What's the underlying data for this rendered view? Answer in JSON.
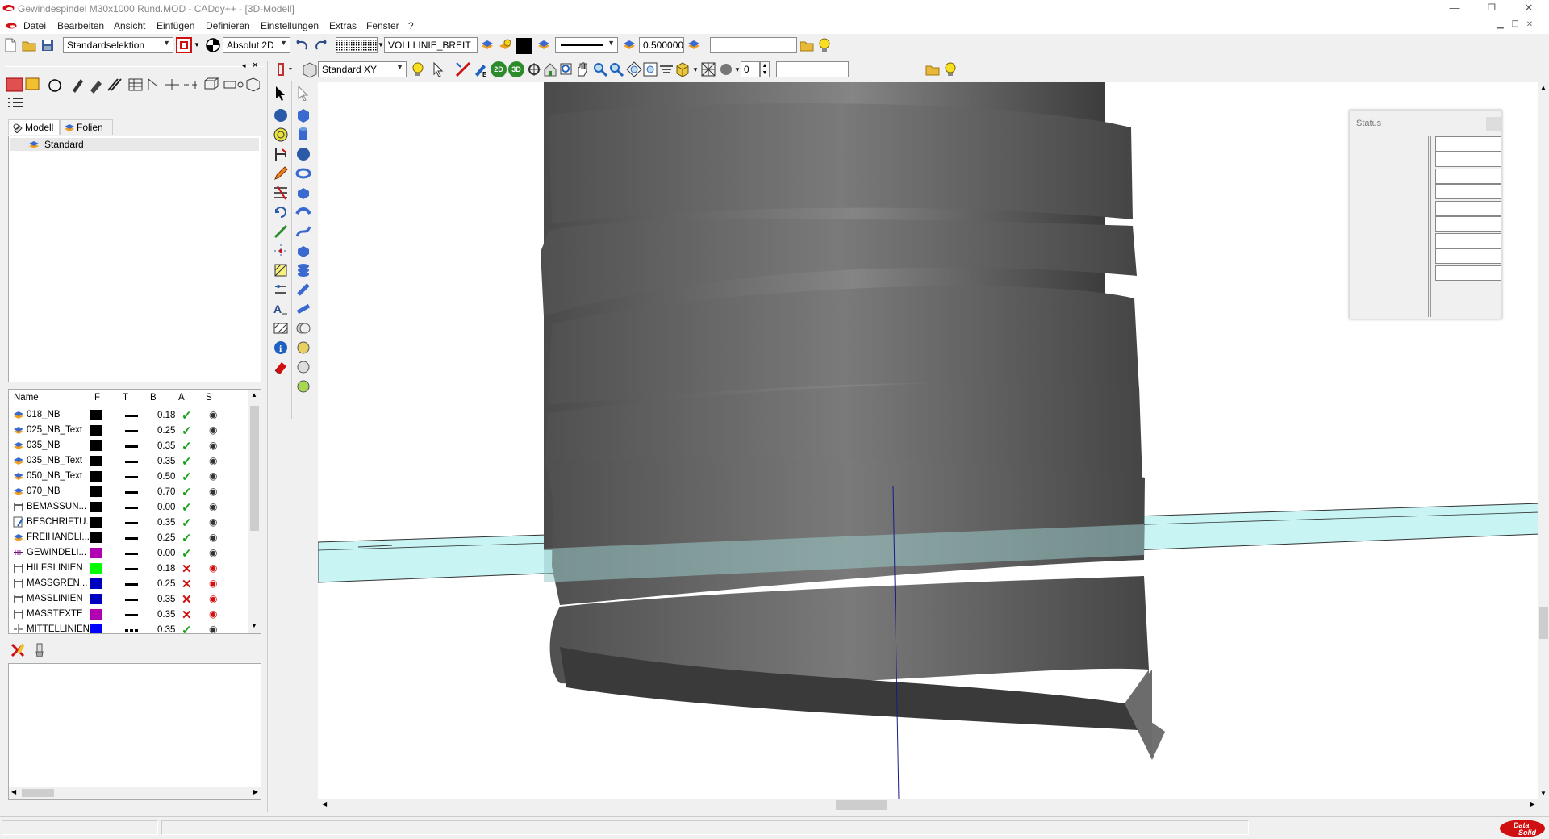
{
  "window": {
    "title": "Gewindespindel M30x1000 Rund.MOD  -  CADdy++ - [3D-Modell]",
    "minimize_glyph": "—",
    "restore_glyph": "❐",
    "close_glyph": "✕"
  },
  "menu": {
    "items": [
      "Datei",
      "Bearbeiten",
      "Ansicht",
      "Einfügen",
      "Definieren",
      "Einstellungen",
      "Extras",
      "Fenster",
      "?"
    ]
  },
  "toolbar1": {
    "selection_mode": "Standardselektion",
    "coord_mode": "Absolut 2D",
    "line_type": "VOLLLINIE_BREIT",
    "line_width": "0.500000",
    "search_value": ""
  },
  "toolbar2": {
    "view_preset": "Standard XY",
    "btn_2d": "2D",
    "btn_3d": "3D",
    "number_value": "0",
    "search_value": ""
  },
  "left_panel": {
    "tabs": [
      {
        "label": "Modell",
        "icon": "model-icon"
      },
      {
        "label": "Folien",
        "icon": "layers-icon"
      }
    ],
    "tree_items": [
      "Standard"
    ],
    "layer_columns": [
      "Name",
      "F",
      "T",
      "B",
      "A",
      "S"
    ],
    "layers": [
      {
        "name": "018_NB",
        "color": "#000000",
        "width": "0.18",
        "active": true
      },
      {
        "name": "025_NB_Text",
        "color": "#000000",
        "width": "0.25",
        "active": true
      },
      {
        "name": "035_NB",
        "color": "#000000",
        "width": "0.35",
        "active": true
      },
      {
        "name": "035_NB_Text",
        "color": "#000000",
        "width": "0.35",
        "active": true
      },
      {
        "name": "050_NB_Text",
        "color": "#000000",
        "width": "0.50",
        "active": true
      },
      {
        "name": "070_NB",
        "color": "#000000",
        "width": "0.70",
        "active": true
      },
      {
        "name": "BEMASSUN...",
        "color": "#000000",
        "width": "0.00",
        "active": true
      },
      {
        "name": "BESCHRIFTU...",
        "color": "#000000",
        "width": "0.35",
        "active": true
      },
      {
        "name": "FREIHANDLI...",
        "color": "#000000",
        "width": "0.25",
        "active": true
      },
      {
        "name": "GEWINDELI...",
        "color": "#b000b0",
        "width": "0.00",
        "active": true
      },
      {
        "name": "HILFSLINIEN",
        "color": "#00ff00",
        "width": "0.18",
        "active": false
      },
      {
        "name": "MASSGREN...",
        "color": "#0000c0",
        "width": "0.25",
        "active": false
      },
      {
        "name": "MASSLINIEN",
        "color": "#0000c0",
        "width": "0.35",
        "active": false
      },
      {
        "name": "MASSTEXTE",
        "color": "#b000b0",
        "width": "0.35",
        "active": false
      },
      {
        "name": "MITTELLINIEN",
        "color": "#0000ff",
        "width": "0.35",
        "active": true
      }
    ]
  },
  "status_window": {
    "title": "Status"
  },
  "brand": {
    "logo_text_1": "Data",
    "logo_text_2": "Solid"
  },
  "colors": {
    "accent_red": "#d01010",
    "check_green": "#18a018",
    "cross_red": "#d01010",
    "model_gray": "#5a5a5a",
    "plane_cyan": "#c8f4f4"
  }
}
